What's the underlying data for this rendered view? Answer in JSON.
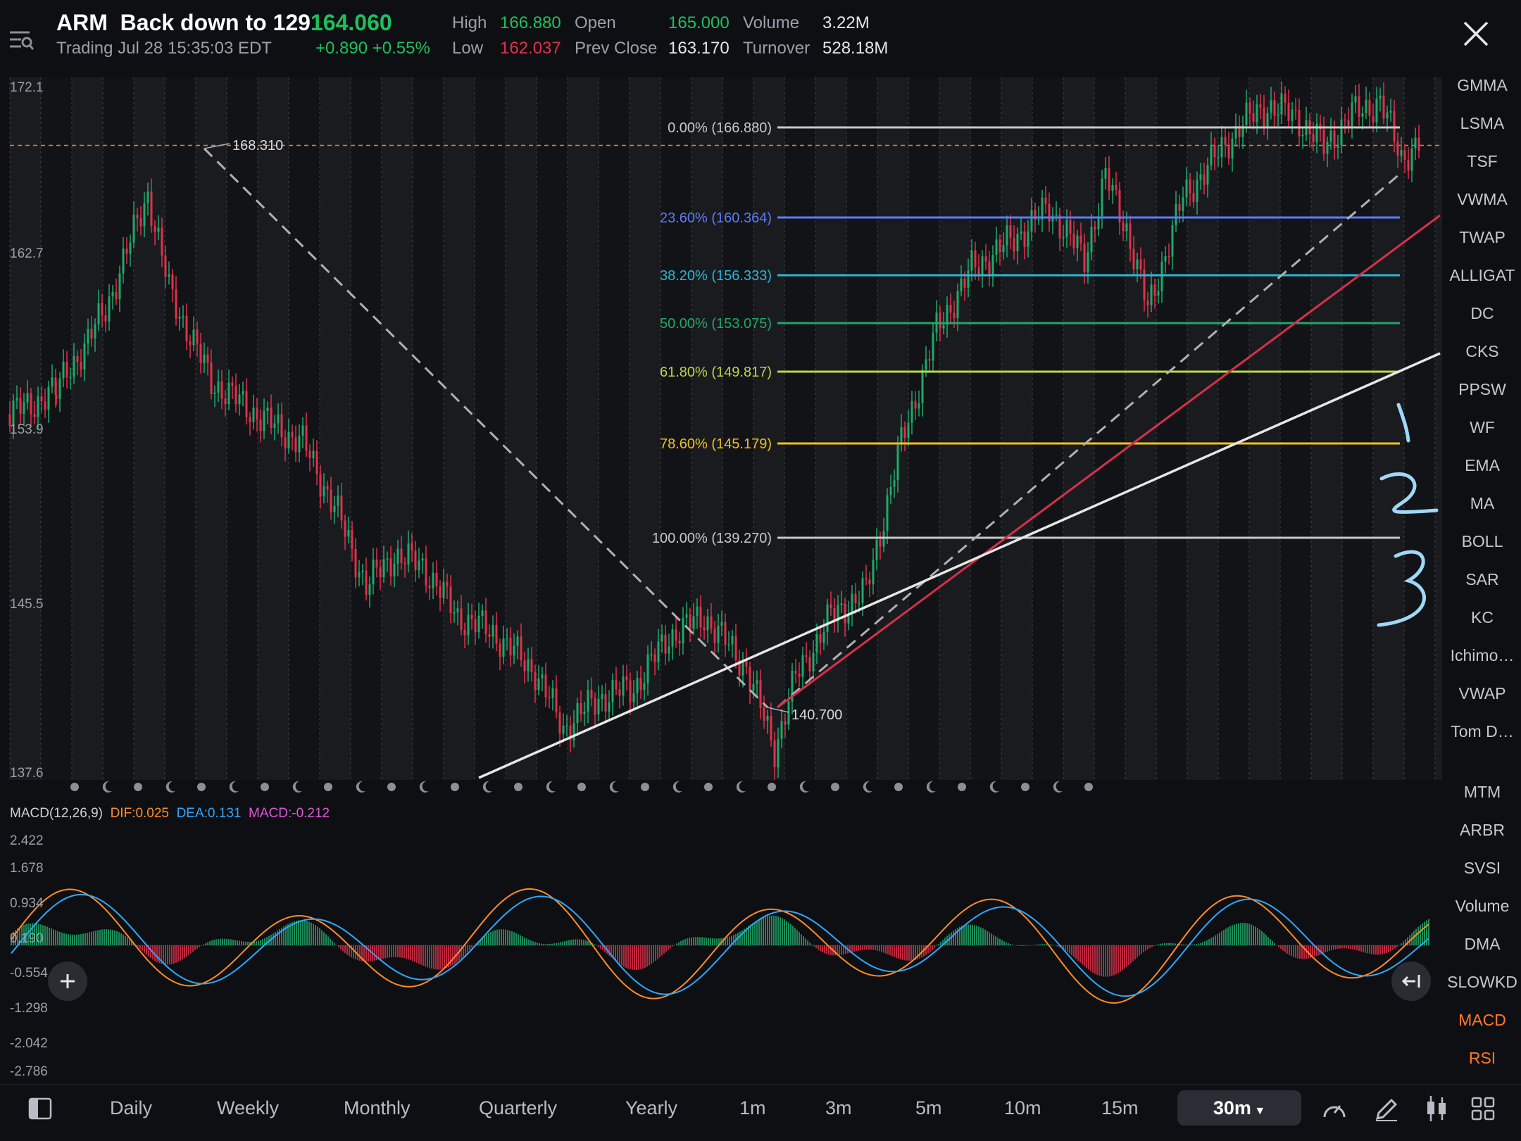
{
  "header": {
    "symbol": "ARM",
    "title_note": "Back down to 129",
    "price": "164.060",
    "status": "Trading Jul 28 15:35:03 EDT",
    "change": "+0.890 +0.55%",
    "stats": {
      "high_label": "High",
      "high": "166.880",
      "low_label": "Low",
      "low": "162.037",
      "open_label": "Open",
      "open": "165.000",
      "prev_close_label": "Prev Close",
      "prev_close": "163.170",
      "volume_label": "Volume",
      "volume": "3.22M",
      "turnover_label": "Turnover",
      "turnover": "528.18M"
    }
  },
  "price_axis": [
    "172.1",
    "162.7",
    "153.9",
    "145.5",
    "137.6"
  ],
  "annotations": {
    "high_marker": "168.310",
    "low_marker": "140.700"
  },
  "fib_levels": [
    {
      "label": "0.00% (166.880)",
      "color": "#c8c8c8"
    },
    {
      "label": "23.60% (160.364)",
      "color": "#5b7cff"
    },
    {
      "label": "38.20% (156.333)",
      "color": "#2bb6d9"
    },
    {
      "label": "50.00% (153.075)",
      "color": "#1fa86a"
    },
    {
      "label": "61.80% (149.817)",
      "color": "#b8d84a"
    },
    {
      "label": "78.60% (145.179)",
      "color": "#f0c020"
    },
    {
      "label": "100.00% (139.270)",
      "color": "#c8c8c8"
    }
  ],
  "macd": {
    "title": "MACD(12,26,9)",
    "dif": "DIF:0.025",
    "dea": "DEA:0.131",
    "macd": "MACD:-0.212",
    "axis": [
      "2.422",
      "1.678",
      "0.934",
      "0.190",
      "-0.554",
      "-1.298",
      "-2.042",
      "-2.786"
    ]
  },
  "indicators": {
    "main": [
      "GMMA",
      "LSMA",
      "TSF",
      "VWMA",
      "TWAP",
      "ALLIGAT",
      "DC",
      "CKS",
      "PPSW",
      "WF",
      "EMA",
      "MA",
      "BOLL",
      "SAR",
      "KC",
      "Ichimo…",
      "VWAP",
      "Tom D…"
    ],
    "sub": [
      "MTM",
      "ARBR",
      "SVSI",
      "Volume",
      "DMA",
      "SLOWKD",
      "MACD",
      "RSI"
    ],
    "active_sub": [
      "MACD",
      "RSI"
    ]
  },
  "timeframes": [
    "Daily",
    "Weekly",
    "Monthly",
    "Quarterly",
    "Yearly",
    "1m",
    "3m",
    "5m",
    "10m",
    "15m"
  ],
  "active_timeframe": "30m",
  "colors": {
    "up": "#1fa86a",
    "down": "#e0304a",
    "active": "#ff7a2a",
    "accent_price": "#1fbf5f"
  },
  "icons": [
    "menu-icon",
    "close-icon",
    "plus-icon",
    "collapse-icon",
    "layout-icon",
    "speed-icon",
    "pencil-icon",
    "candles-icon",
    "grid-icon"
  ]
}
